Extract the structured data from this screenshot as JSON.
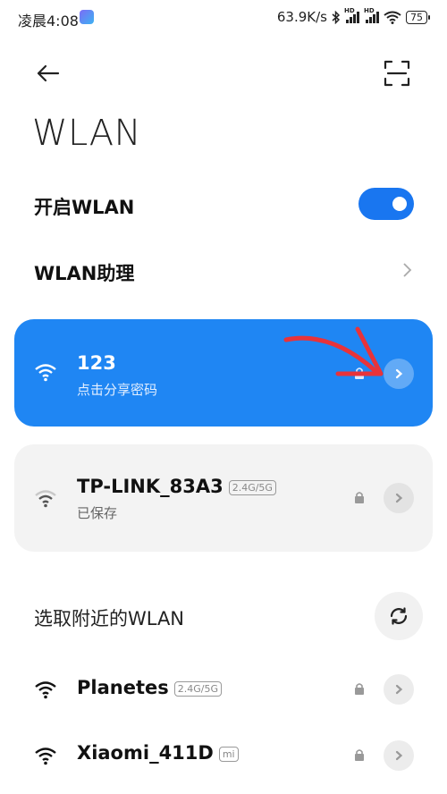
{
  "status_bar": {
    "time": "凌晨4:08",
    "network_speed": "63.9K/s",
    "hd_label": "HD",
    "battery": "75",
    "icons": [
      "app-notification-icon",
      "bluetooth-icon",
      "signal-icon",
      "signal-icon",
      "wifi-icon",
      "battery-icon"
    ]
  },
  "header": {
    "title": "WLAN",
    "back_icon": "back-arrow-icon",
    "scan_icon": "scan-icon"
  },
  "wlan_toggle": {
    "label": "开启WLAN",
    "state": "on"
  },
  "wlan_assistant": {
    "label": "WLAN助理"
  },
  "connected_network": {
    "name": "123",
    "subtitle": "点击分享密码"
  },
  "saved_network": {
    "name": "TP-LINK_83A3",
    "band": "2.4G/5G",
    "subtitle": "已保存"
  },
  "nearby": {
    "title": "选取附近的WLAN",
    "networks": [
      {
        "name": "Planetes",
        "tag": "2.4G/5G"
      },
      {
        "name": "Xiaomi_411D",
        "tag": "mi"
      }
    ]
  },
  "colors": {
    "accent": "#1f86f3",
    "toggle": "#1976f0",
    "annotation_arrow": "#e8333a"
  }
}
